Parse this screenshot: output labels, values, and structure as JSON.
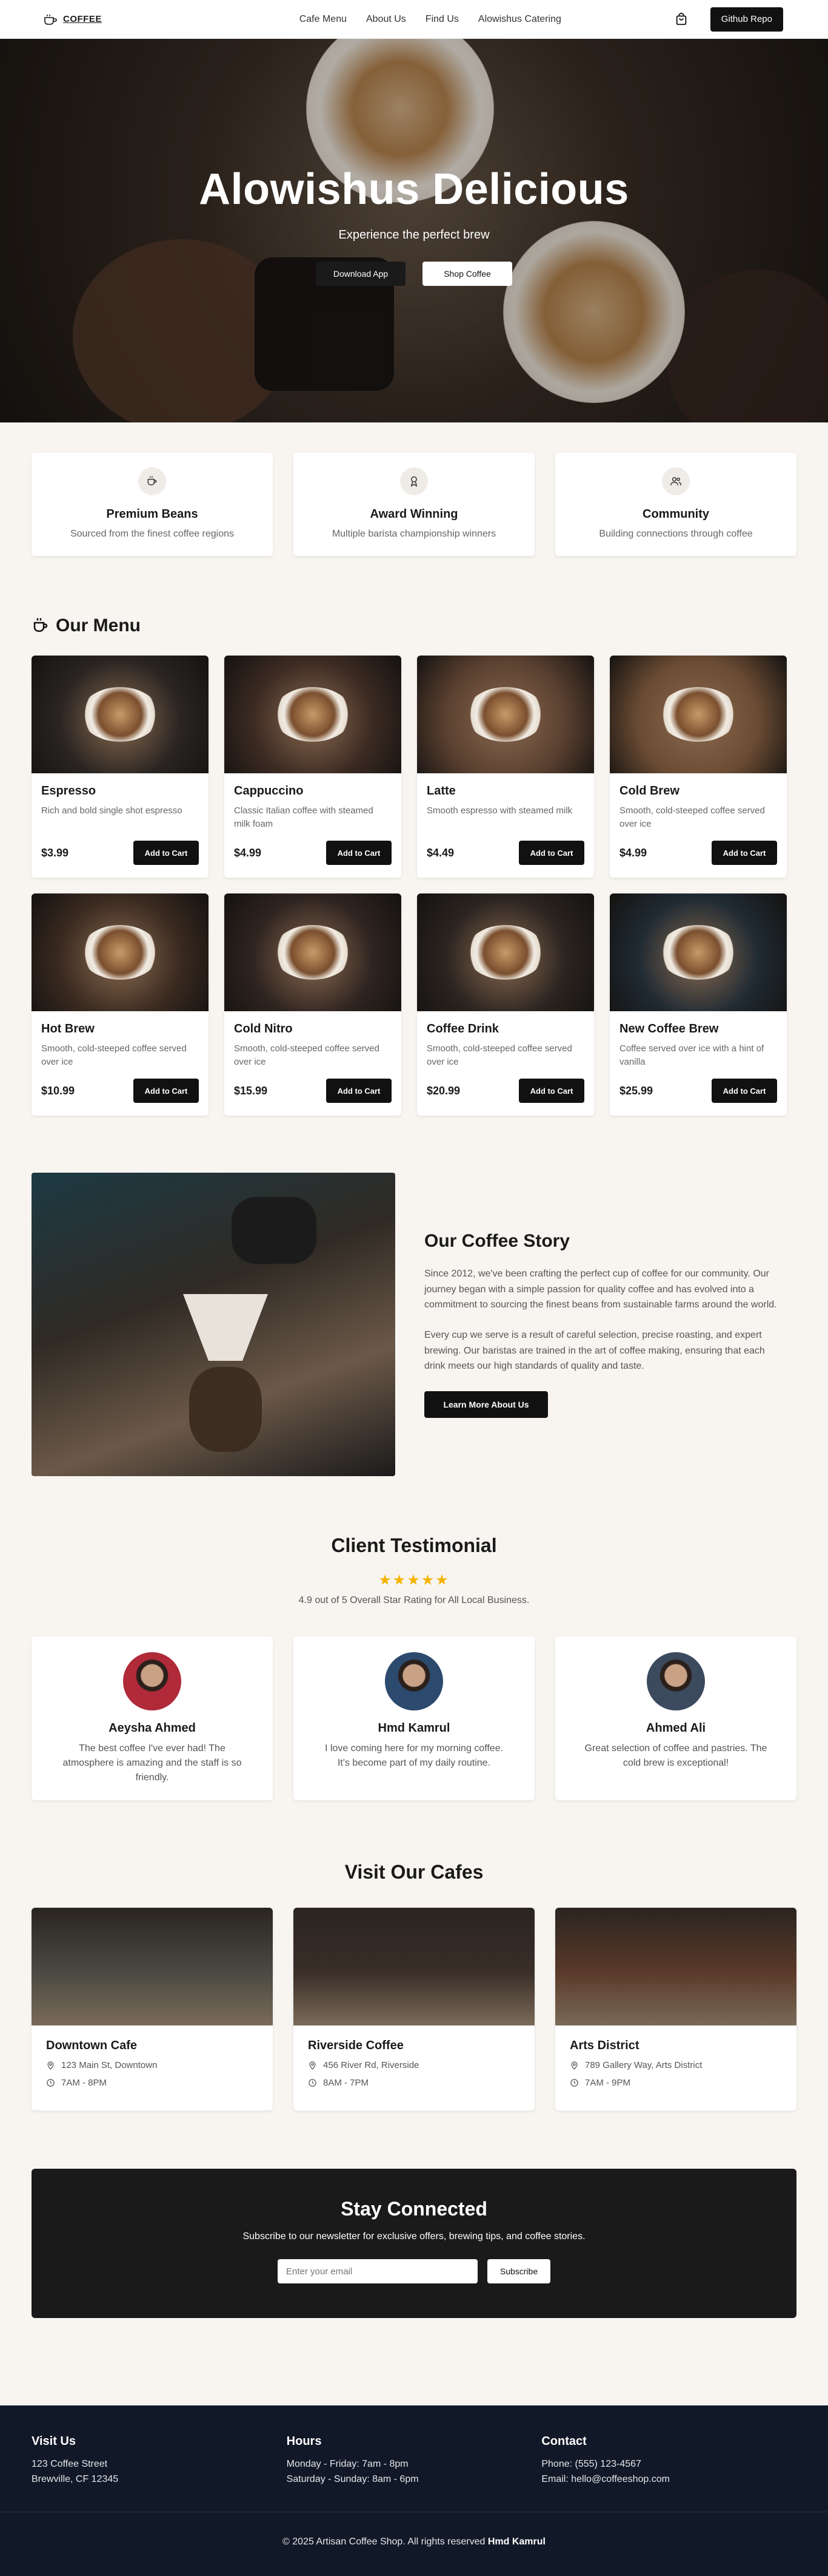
{
  "nav": {
    "logo_text": "COFFEE",
    "links": [
      "Cafe Menu",
      "About Us",
      "Find Us",
      "Alowishus Catering"
    ],
    "github_label": "Github Repo"
  },
  "hero": {
    "title": "Alowishus Delicious",
    "subtitle": "Experience the perfect brew",
    "btn_download": "Download App",
    "btn_shop": "Shop Coffee"
  },
  "features": [
    {
      "icon": "coffee-cup-icon",
      "title": "Premium Beans",
      "desc": "Sourced from the finest coffee regions"
    },
    {
      "icon": "award-icon",
      "title": "Award Winning",
      "desc": "Multiple barista championship winners"
    },
    {
      "icon": "users-icon",
      "title": "Community",
      "desc": "Building connections through coffee"
    }
  ],
  "menu": {
    "title": "Our Menu",
    "add_label": "Add to Cart",
    "items": [
      {
        "name": "Espresso",
        "desc": "Rich and bold single shot espresso",
        "price": "$3.99",
        "color": "#2a2522"
      },
      {
        "name": "Cappuccino",
        "desc": "Classic Italian coffee with steamed milk foam",
        "price": "$4.99",
        "color": "#3b2a22"
      },
      {
        "name": "Latte",
        "desc": "Smooth espresso with steamed milk",
        "price": "$4.49",
        "color": "#5a4030"
      },
      {
        "name": "Cold Brew",
        "desc": "Smooth, cold-steeped coffee served over ice",
        "price": "$4.99",
        "color": "#6a4b33"
      },
      {
        "name": "Hot Brew",
        "desc": "Smooth, cold-steeped coffee served over ice",
        "price": "$10.99",
        "color": "#3a2a20"
      },
      {
        "name": "Cold Nitro",
        "desc": "Smooth, cold-steeped coffee served over ice",
        "price": "$15.99",
        "color": "#2f2420"
      },
      {
        "name": "Coffee Drink",
        "desc": "Smooth, cold-steeped coffee served over ice",
        "price": "$20.99",
        "color": "#2b2420"
      },
      {
        "name": "New Coffee Brew",
        "desc": "Coffee served over ice with a hint of vanilla",
        "price": "$25.99",
        "color": "#1f2a33"
      }
    ]
  },
  "story": {
    "title": "Our Coffee Story",
    "p1": "Since 2012, we've been crafting the perfect cup of coffee for our community. Our journey began with a simple passion for quality coffee and has evolved into a commitment to sourcing the finest beans from sustainable farms around the world.",
    "p2": "Every cup we serve is a result of careful selection, precise roasting, and expert brewing. Our baristas are trained in the art of coffee making, ensuring that each drink meets our high standards of quality and taste.",
    "btn": "Learn More About Us"
  },
  "testimonials": {
    "title": "Client Testimonial",
    "stars": "★★★★★",
    "rating_text": "4.9 out of 5 Overall Star Rating for All Local Business.",
    "items": [
      {
        "name": "Aeysha Ahmed",
        "quote": "The best coffee I've ever had! The atmosphere is amazing and the staff is so friendly.",
        "color": "#b02a3a"
      },
      {
        "name": "Hmd Kamrul",
        "quote": "I love coming here for my morning coffee. It's become part of my daily routine.",
        "color": "#2c4a6e"
      },
      {
        "name": "Ahmed Ali",
        "quote": "Great selection of coffee and pastries. The cold brew is exceptional!",
        "color": "#3c4a5e"
      }
    ]
  },
  "cafes": {
    "title": "Visit Our Cafes",
    "items": [
      {
        "name": "Downtown Cafe",
        "address": "123 Main St, Downtown",
        "hours": "7AM - 8PM",
        "color": "#4a4a42"
      },
      {
        "name": "Riverside Coffee",
        "address": "456 River Rd, Riverside",
        "hours": "8AM - 7PM",
        "color": "#3a2e28"
      },
      {
        "name": "Arts District",
        "address": "789 Gallery Way, Arts District",
        "hours": "7AM - 9PM",
        "color": "#5a3a2a"
      }
    ]
  },
  "newsletter": {
    "title": "Stay Connected",
    "desc": "Subscribe to our newsletter for exclusive offers, brewing tips, and coffee stories.",
    "placeholder": "Enter your email",
    "btn": "Subscribe"
  },
  "footer": {
    "visit_title": "Visit Us",
    "visit_l1": "123 Coffee Street",
    "visit_l2": "Brewville, CF 12345",
    "hours_title": "Hours",
    "hours_l1": "Monday - Friday: 7am - 8pm",
    "hours_l2": "Saturday - Sunday: 8am - 6pm",
    "contact_title": "Contact",
    "contact_l1": "Phone: (555) 123-4567",
    "contact_l2": "Email: hello@coffeeshop.com",
    "copyright": "© 2025 Artisan Coffee Shop. All rights reserved",
    "author": "Hmd Kamrul"
  }
}
